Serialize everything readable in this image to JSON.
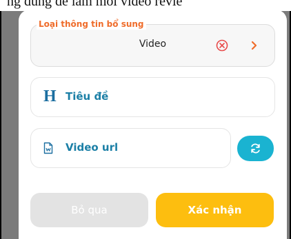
{
  "background": {
    "partial_text": "ng dung de lam moi video revie"
  },
  "modal": {
    "type_field": {
      "legend": "Loại thông tin bổ sung",
      "value": "Video"
    },
    "title_field": {
      "icon": "heading-icon",
      "placeholder": "Tiêu đề"
    },
    "url_field": {
      "icon": "document-icon",
      "placeholder": "Video url"
    },
    "buttons": {
      "skip": "Bỏ qua",
      "confirm": "Xác nhận"
    }
  },
  "colors": {
    "legend": "#ef6c2a",
    "label": "#1b7fa6",
    "refresh": "#1ab3d1",
    "confirm": "#fdbe0f",
    "skip": "#e3e3e3",
    "clear": "#e84a4a"
  }
}
